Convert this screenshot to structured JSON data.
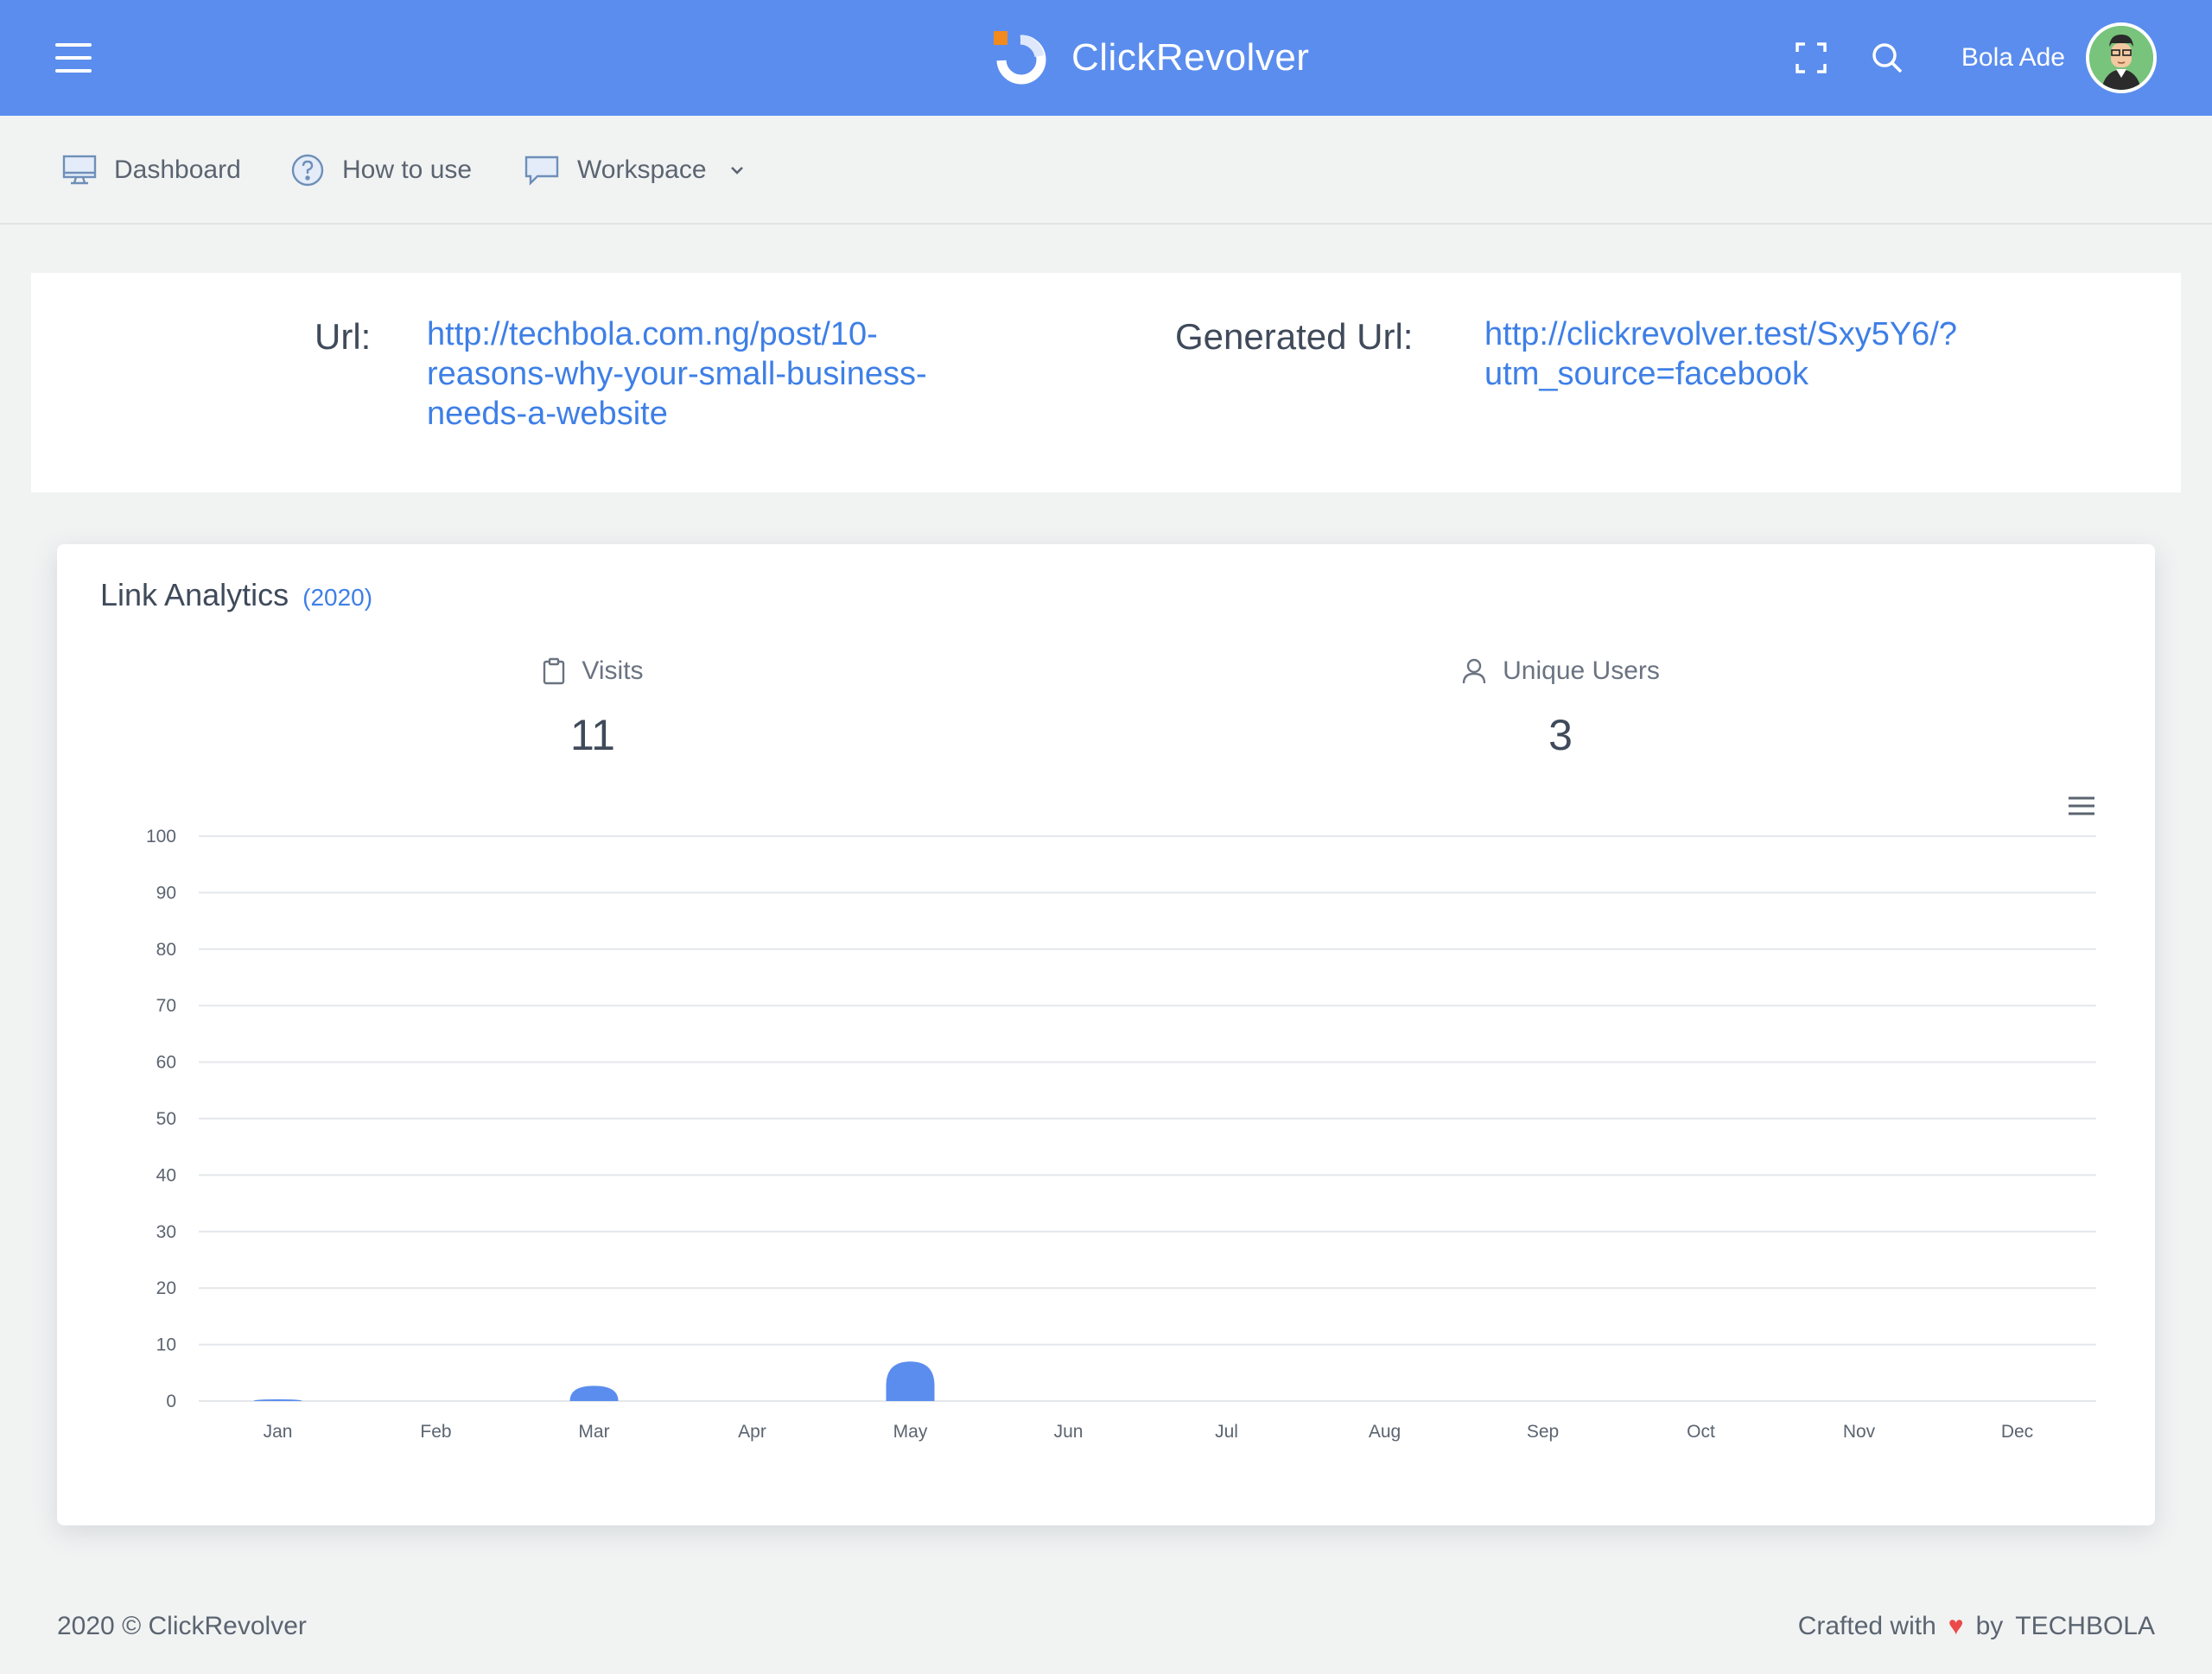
{
  "header": {
    "brand_name": "ClickRevolver",
    "user_name": "Bola Ade",
    "brand_color": "#5b8dee",
    "logo_accent": "#f28a1d"
  },
  "nav": {
    "items": [
      {
        "label": "Dashboard",
        "icon": "monitor-icon"
      },
      {
        "label": "How to use",
        "icon": "question-circle-icon"
      },
      {
        "label": "Workspace",
        "icon": "chat-bubble-icon",
        "has_dropdown": true
      }
    ]
  },
  "url_card": {
    "url_label": "Url:",
    "url_lines": [
      "http://techbola.com.ng/post/10-",
      "reasons-why-your-small-business-",
      "needs-a-website"
    ],
    "generated_label": "Generated Url:",
    "generated_lines": [
      "http://clickrevolver.test/Sxy5Y6/?",
      "utm_source=facebook"
    ],
    "link_color": "#3e7fe6"
  },
  "analytics": {
    "title": "Link Analytics",
    "year": "(2020)",
    "visits_label": "Visits",
    "visits_value": "11",
    "users_label": "Unique Users",
    "users_value": "3"
  },
  "chart_data": {
    "type": "bar",
    "categories": [
      "Jan",
      "Feb",
      "Mar",
      "Apr",
      "May",
      "Jun",
      "Jul",
      "Aug",
      "Sep",
      "Oct",
      "Nov",
      "Dec"
    ],
    "values": [
      0.3,
      0,
      2.7,
      0,
      7,
      0,
      0,
      0,
      0,
      0,
      0,
      0
    ],
    "ylim": [
      0,
      100
    ],
    "yticks": [
      0,
      10,
      20,
      30,
      40,
      50,
      60,
      70,
      80,
      90,
      100
    ],
    "bar_color": "#5b8dee",
    "grid": true
  },
  "footer": {
    "copyright": "2020 © ClickRevolver",
    "crafted": "Crafted with",
    "by": "by",
    "author": "TECHBOLA"
  }
}
